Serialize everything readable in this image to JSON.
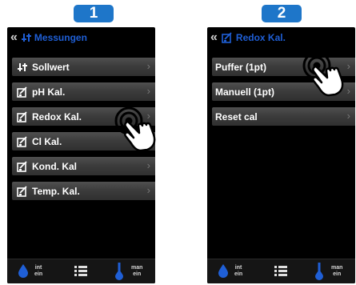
{
  "steps": [
    {
      "number": "1",
      "header": {
        "back": "«",
        "title": "Messungen",
        "icon": "sliders-icon"
      },
      "items": [
        {
          "label": "Sollwert",
          "icon": "sliders-icon"
        },
        {
          "label": "pH Kal.",
          "icon": "calibration-icon"
        },
        {
          "label": "Redox Kal.",
          "icon": "calibration-icon",
          "pressed": true
        },
        {
          "label": "Cl Kal.",
          "icon": "calibration-icon"
        },
        {
          "label": "Kond. Kal",
          "icon": "calibration-icon"
        },
        {
          "label": "Temp. Kal.",
          "icon": "calibration-icon"
        }
      ],
      "footer": {
        "left_text": "int\nein",
        "right_text": "man\nein"
      }
    },
    {
      "number": "2",
      "header": {
        "back": "«",
        "title": "Redox Kal.",
        "icon": "calibration-icon"
      },
      "items": [
        {
          "label": "Puffer (1pt)",
          "pressed": true
        },
        {
          "label": "Manuell (1pt)"
        },
        {
          "label": "Reset cal"
        }
      ],
      "footer": {
        "left_text": "int\nein",
        "right_text": "man\nein"
      }
    }
  ],
  "chevron": "›",
  "colors": {
    "badge": "#1e76c9",
    "header_title": "#1f5fd6",
    "row_text": "#ffffff",
    "screen_bg": "#000000",
    "drop": "#1f5fd6"
  }
}
